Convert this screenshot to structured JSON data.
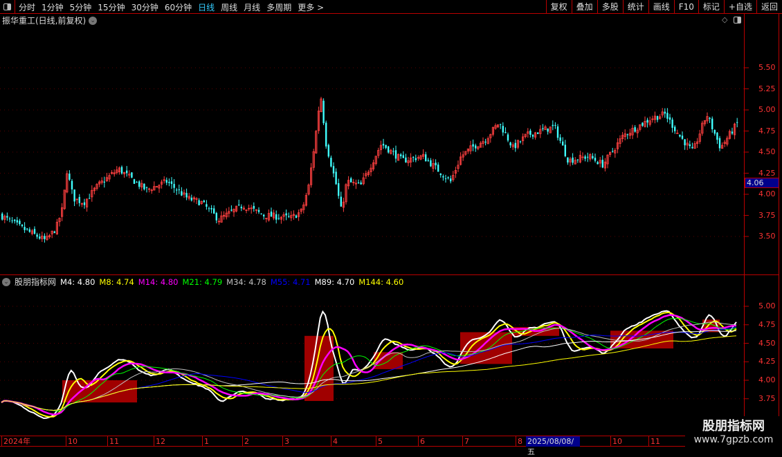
{
  "toolbar": {
    "periods": [
      "分时",
      "1分钟",
      "5分钟",
      "15分钟",
      "30分钟",
      "60分钟",
      "日线",
      "周线",
      "月线",
      "多周期",
      "更多 >"
    ],
    "active": "日线",
    "buttons": [
      "复权",
      "叠加",
      "多股",
      "统计",
      "画线",
      "F10",
      "标记",
      "+自选",
      "返回"
    ]
  },
  "main": {
    "title": "振华重工(日线,前复权)",
    "y_ticks": [
      "5.50",
      "5.25",
      "5.00",
      "4.75",
      "4.50",
      "4.25",
      "4.00",
      "3.75",
      "3.50"
    ],
    "current_price": "4.06"
  },
  "indicator": {
    "name": "股朋指标网",
    "values": [
      {
        "label": "M4: 4.80",
        "color": "#ffffff"
      },
      {
        "label": "M8: 4.74",
        "color": "#ffff00"
      },
      {
        "label": "M14: 4.80",
        "color": "#ff00ff"
      },
      {
        "label": "M21: 4.79",
        "color": "#00ff00"
      },
      {
        "label": "M34: 4.78",
        "color": "#c0c0c0"
      },
      {
        "label": "M55: 4.71",
        "color": "#0000ff"
      },
      {
        "label": "M89: 4.70",
        "color": "#ffffff"
      },
      {
        "label": "M144: 4.60",
        "color": "#ffff00"
      }
    ],
    "y_ticks": [
      "5.00",
      "4.75",
      "4.50",
      "4.25",
      "4.00",
      "3.75"
    ]
  },
  "dates": {
    "labels": [
      "2024年",
      "10",
      "11",
      "12",
      "1",
      "2",
      "3",
      "4",
      "5",
      "6",
      "7",
      "8",
      "10",
      "11"
    ],
    "cursor_date": "2025/08/08/五"
  },
  "watermark": {
    "title": "股朋指标网",
    "url": "www.7gpzb.com"
  },
  "chart_data": {
    "type": "candlestick",
    "note": "approximate close path",
    "path": [
      [
        0,
        3.75
      ],
      [
        30,
        3.6
      ],
      [
        65,
        3.45
      ],
      [
        80,
        3.6
      ],
      [
        90,
        3.85
      ],
      [
        95,
        4.3
      ],
      [
        105,
        3.95
      ],
      [
        120,
        3.9
      ],
      [
        140,
        4.1
      ],
      [
        170,
        4.3
      ],
      [
        210,
        4.05
      ],
      [
        240,
        4.15
      ],
      [
        270,
        3.95
      ],
      [
        290,
        3.9
      ],
      [
        315,
        3.7
      ],
      [
        350,
        3.87
      ],
      [
        380,
        3.75
      ],
      [
        420,
        3.72
      ],
      [
        435,
        3.8
      ],
      [
        445,
        4.1
      ],
      [
        455,
        4.7
      ],
      [
        462,
        5.2
      ],
      [
        470,
        4.6
      ],
      [
        485,
        4.1
      ],
      [
        492,
        3.8
      ],
      [
        500,
        4.15
      ],
      [
        520,
        4.1
      ],
      [
        550,
        4.6
      ],
      [
        580,
        4.4
      ],
      [
        610,
        4.45
      ],
      [
        630,
        4.3
      ],
      [
        650,
        4.15
      ],
      [
        665,
        4.45
      ],
      [
        680,
        4.55
      ],
      [
        700,
        4.65
      ],
      [
        720,
        4.85
      ],
      [
        740,
        4.55
      ],
      [
        760,
        4.7
      ],
      [
        800,
        4.8
      ],
      [
        820,
        4.4
      ],
      [
        850,
        4.45
      ],
      [
        870,
        4.35
      ],
      [
        900,
        4.7
      ],
      [
        940,
        4.9
      ],
      [
        960,
        4.95
      ],
      [
        980,
        4.7
      ],
      [
        1000,
        4.5
      ],
      [
        1020,
        4.95
      ],
      [
        1040,
        4.55
      ],
      [
        1065,
        4.85
      ]
    ]
  }
}
